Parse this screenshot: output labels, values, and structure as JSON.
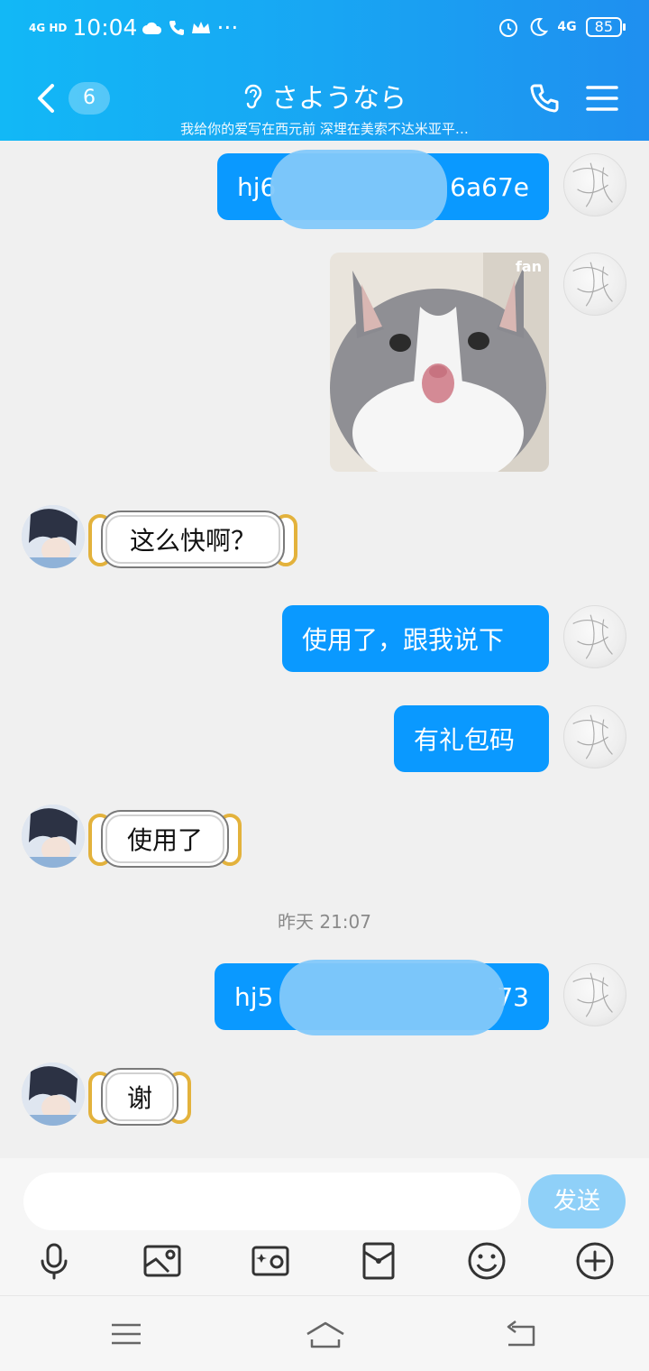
{
  "status_bar": {
    "network": "4G HD",
    "time": "10:04",
    "right_network": "4G",
    "battery": "85"
  },
  "header": {
    "unread_count": "6",
    "title": "さようなら",
    "subtitle": "我给你的爱写在西元前 深埋在美索不达米亚平…"
  },
  "messages": [
    {
      "side": "me",
      "type": "text",
      "text_start": "hj6",
      "text_end": "6a67e",
      "redacted": true
    },
    {
      "side": "me",
      "type": "image",
      "overlay_text": "fan"
    },
    {
      "side": "other",
      "type": "text",
      "text": "这么快啊？"
    },
    {
      "side": "me",
      "type": "text",
      "text": "使用了，跟我说下"
    },
    {
      "side": "me",
      "type": "text",
      "text": "有礼包码"
    },
    {
      "side": "other",
      "type": "text",
      "text": "使用了"
    },
    {
      "side": "system",
      "type": "timestamp",
      "text": "昨天 21:07"
    },
    {
      "side": "me",
      "type": "text",
      "text_start": "hj5",
      "text_end": "73",
      "redacted": true
    },
    {
      "side": "other",
      "type": "text",
      "text": "谢"
    }
  ],
  "input_bar": {
    "placeholder": "",
    "send_label": "发送",
    "tools": [
      "microphone-icon",
      "image-icon",
      "camera-icon",
      "red-packet-icon",
      "emoji-icon",
      "plus-icon"
    ]
  },
  "colors": {
    "header_gradient_start": "#12b8f6",
    "header_gradient_end": "#1f8ff0",
    "my_bubble": "#0a99ff",
    "send_button": "#8fd0f8",
    "chat_background": "#f0f0f0"
  }
}
